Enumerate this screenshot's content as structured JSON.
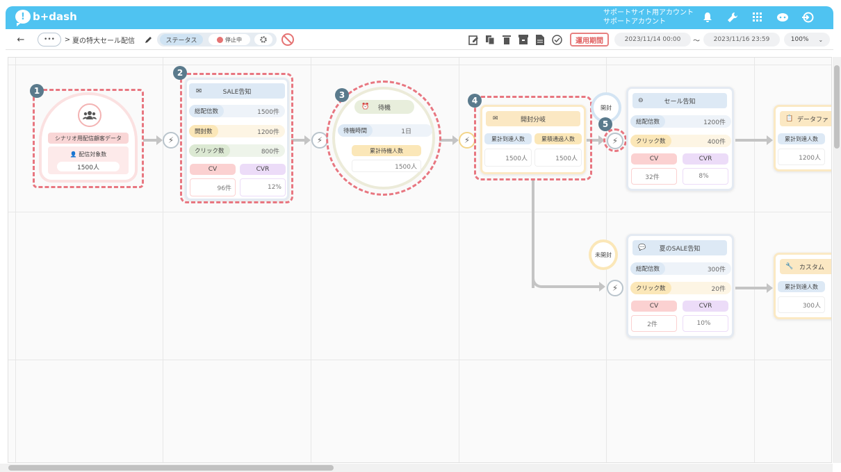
{
  "app": {
    "logo": "b+dash",
    "account_line1": "サポートサイト用アカウント",
    "account_line2": "サポートアカウント"
  },
  "toolbar": {
    "back": "←",
    "more": "•••",
    "breadcrumb_sep": ">",
    "scenario_name": "夏の特大セール配信",
    "status_label": "ステータス",
    "status_value": "停止中",
    "period_button": "運用期間",
    "date_start": "2023/11/14 00:00",
    "date_sep": "〜",
    "date_end": "2023/11/16 23:59",
    "zoom": "100%"
  },
  "nodes": {
    "segment": {
      "title": "シナリオ用配信顧客データ",
      "count_label": "配信対象数",
      "count_value": "1500人"
    },
    "sale": {
      "title": "SALE告知",
      "r1": "総配信数",
      "v1": "1500件",
      "r2": "開封数",
      "v2": "1200件",
      "r3": "クリック数",
      "v3": "800件",
      "cv": "CV",
      "cvr": "CVR",
      "cv_val": "96件",
      "cvr_val": "12%"
    },
    "wait": {
      "title": "待機",
      "time_label": "待機時間",
      "time_value": "1日",
      "acc_label": "累計待機人数",
      "acc_value": "1500人"
    },
    "branch": {
      "title": "開封分岐",
      "c1": "累計到達人数",
      "c2": "累積通過人数",
      "v1": "1500人",
      "v2": "1500人"
    },
    "sale2": {
      "title": "セール告知",
      "r1": "総配信数",
      "v1": "1200件",
      "r2": "クリック数",
      "v2": "400件",
      "cv": "CV",
      "cvr": "CVR",
      "cv_val": "32件",
      "cvr_val": "8%"
    },
    "data": {
      "title": "データファ",
      "c1": "累計到達人数",
      "v1": "1200人"
    },
    "summer": {
      "title": "夏のSALE告知",
      "r1": "総配信数",
      "v1": "300件",
      "r2": "クリック数",
      "v2": "20件",
      "cv": "CV",
      "cvr": "CVR",
      "cv_val": "2件",
      "cvr_val": "10%"
    },
    "custom": {
      "title": "カスタム",
      "c1": "累計到達人数",
      "v1": "300人"
    },
    "opened": "開封",
    "unopened": "未開封"
  },
  "badges": [
    "1",
    "2",
    "3",
    "4",
    "5"
  ]
}
